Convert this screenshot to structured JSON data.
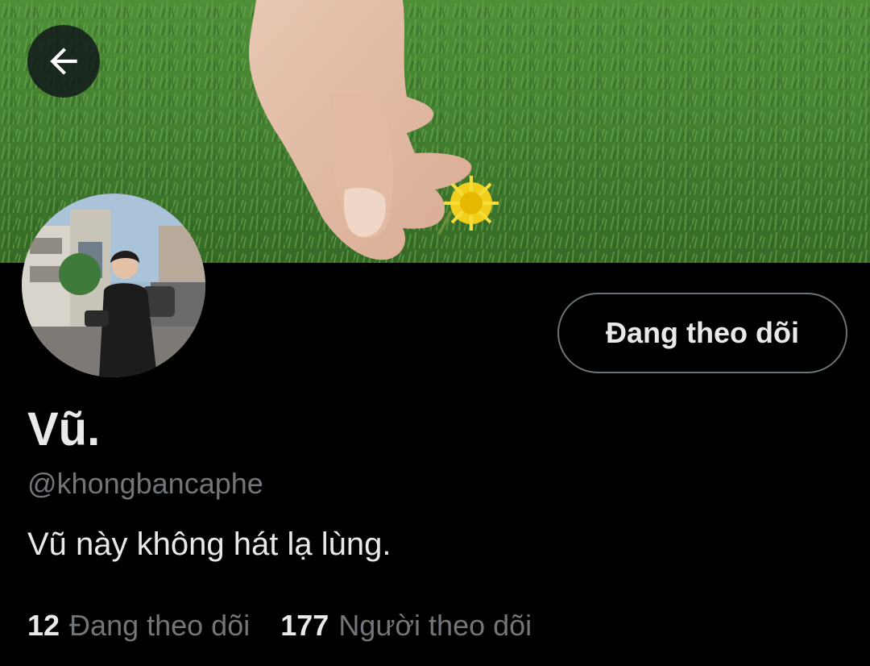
{
  "colors": {
    "background": "#000000",
    "text_primary": "#e7e9ea",
    "text_secondary": "#71767b",
    "button_border": "#6b7378"
  },
  "header": {
    "back_icon": "arrow-left-icon",
    "banner": "banner-image"
  },
  "profile": {
    "avatar": "avatar-image",
    "follow_button_label": "Đang theo dõi",
    "display_name": "Vũ.",
    "handle": "@khongbancaphe",
    "bio": "Vũ này không hát lạ lùng."
  },
  "stats": {
    "following_count": "12",
    "following_label": "Đang theo dõi",
    "followers_count": "177",
    "followers_label": "Người theo dõi"
  }
}
